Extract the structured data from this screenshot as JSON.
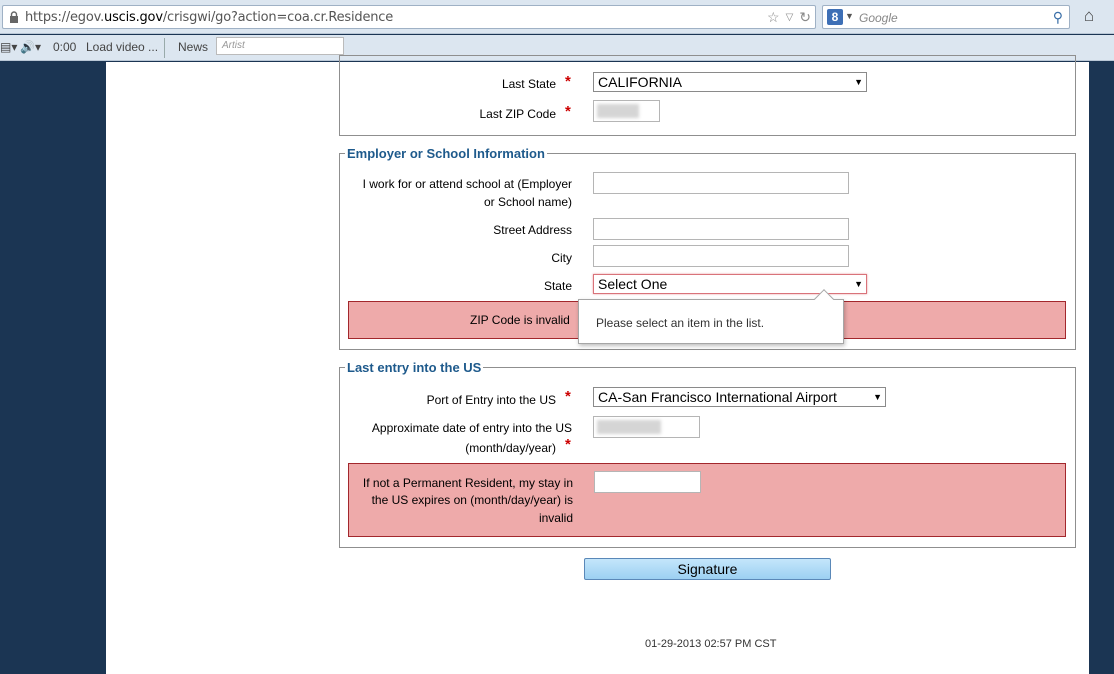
{
  "browser": {
    "url_prefix": "https://egov.",
    "url_domain": "uscis.gov",
    "url_suffix": "/crisgwi/go?action=coa.cr.Residence",
    "search_placeholder": "Google",
    "search_engine_icon": "8",
    "icons": [
      "lock-icon",
      "star-icon",
      "dropdown-icon",
      "reload-icon",
      "search-icon",
      "home-icon"
    ]
  },
  "toolbar": {
    "time": "0:00",
    "load_video": "Load video ...",
    "news": "News",
    "artist_placeholder": "Artist"
  },
  "residence": {
    "last_state_label": "Last State",
    "last_state_value": "CALIFORNIA",
    "last_zip_label": "Last ZIP Code"
  },
  "employer": {
    "legend": "Employer or School Information",
    "work_label_1": "I work for or attend school at (Employer",
    "work_label_2": "or School name)",
    "street_label": "Street Address",
    "city_label": "City",
    "state_label": "State",
    "state_value": "Select One",
    "zip_error": "ZIP Code is invalid",
    "tooltip": "Please select an item in the list."
  },
  "entry": {
    "legend": "Last entry into the US",
    "port_label": "Port of Entry into the US",
    "port_value": "CA-San Francisco International Airport",
    "date_label_1": "Approximate date of entry into the US",
    "date_label_2": "(month/day/year)",
    "stay_error_1": "If not a Permanent Resident, my stay in",
    "stay_error_2": "the US expires on (month/day/year) is",
    "stay_error_3": "invalid"
  },
  "signature_button": "Signature",
  "timestamp": "01-29-2013 02:57 PM CST",
  "colors": {
    "legend": "#1e5a8c",
    "error_bg": "#eeaaaa",
    "error_border": "#a2272c",
    "required": "#cc0000",
    "page_bg": "#1b3553"
  }
}
